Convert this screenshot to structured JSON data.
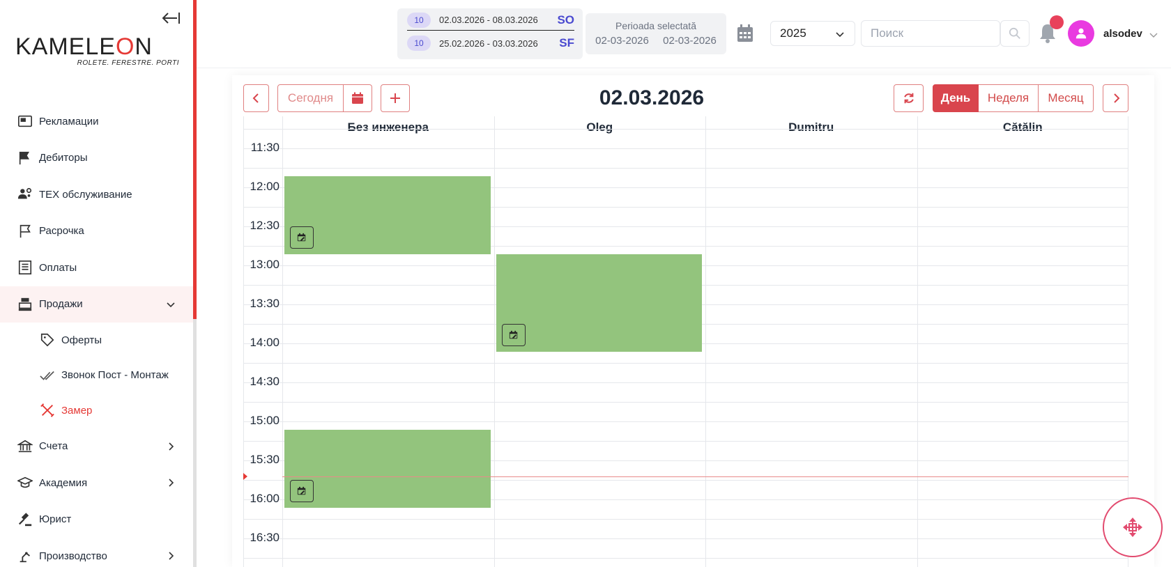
{
  "sidebar": {
    "logo": {
      "main_prefix": "KAMELE",
      "main_o": "O",
      "main_suffix": "N",
      "tagline": "ROLETE. FERESTRE. PORTI"
    },
    "items": [
      {
        "label": "Рекламации",
        "icon": "card-icon"
      },
      {
        "label": "Дебиторы",
        "icon": "bookmark-icon"
      },
      {
        "label": "ТЕХ обслуживание",
        "icon": "users-gear-icon"
      },
      {
        "label": "Расрочка",
        "icon": "bookmark-outline-icon"
      },
      {
        "label": "Оплаты",
        "icon": "receipt-icon"
      },
      {
        "label": "Продажи",
        "icon": "cash-register-icon"
      },
      {
        "label": "Счета",
        "icon": "bank-icon"
      },
      {
        "label": "Академия",
        "icon": "graduation-cap-icon"
      },
      {
        "label": "Юрист",
        "icon": "gavel-icon"
      },
      {
        "label": "Производство",
        "icon": "robot-arm-icon"
      }
    ],
    "sub_items": [
      {
        "label": "Оферты",
        "icon": "tag-icon"
      },
      {
        "label": "Звонок Пост - Монтаж",
        "icon": "double-check-icon"
      },
      {
        "label": "Замер",
        "icon": "ruler-pencil-icon"
      }
    ]
  },
  "header": {
    "periods": [
      {
        "badge": "10",
        "dates": "02.03.2026 - 08.03.2026",
        "code": "SO"
      },
      {
        "badge": "10",
        "dates": "25.02.2026 - 03.03.2026",
        "code": "SF"
      }
    ],
    "selected_period": {
      "title": "Perioada selectată",
      "from": "02-03-2026",
      "to": "02-03-2026"
    },
    "year": "2025",
    "search_placeholder": "Поиск",
    "username": "alsodev",
    "colors": {
      "accent": "#e53935",
      "avatar": "#e93ae0",
      "notification": "#e8415b"
    }
  },
  "calendar": {
    "today_label": "Сегодня",
    "title": "02.03.2026",
    "views": {
      "day": "День",
      "week": "Неделя",
      "month": "Месяц"
    },
    "active_view": "day",
    "columns": [
      "Без инженера",
      "Oleg",
      "Dumitru",
      "Cătălin"
    ],
    "times": [
      "11:30",
      "12:00",
      "12:30",
      "13:00",
      "13:30",
      "14:00",
      "14:30",
      "15:00",
      "15:30",
      "16:00",
      "16:30"
    ],
    "events": [
      {
        "column": 0,
        "start": "12:00",
        "end": "13:00",
        "color": "#93c47d"
      },
      {
        "column": 1,
        "start": "13:00",
        "end": "14:15",
        "color": "#93c47d"
      },
      {
        "column": 0,
        "start": "15:15",
        "end": "16:15",
        "color": "#93c47d"
      }
    ],
    "now": "15:51"
  }
}
